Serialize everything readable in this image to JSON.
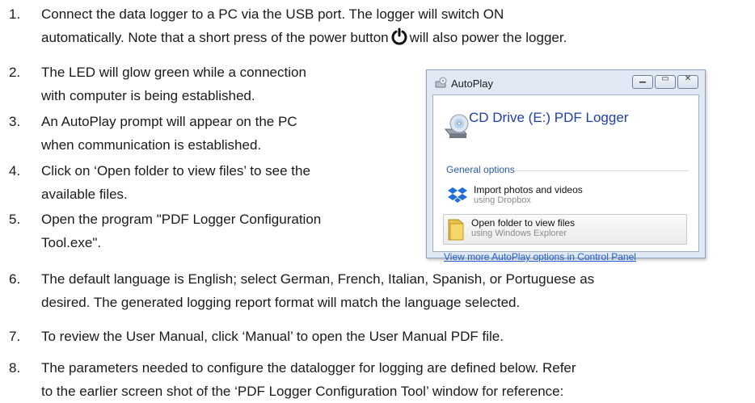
{
  "steps": [
    {
      "num": "1.",
      "lines": [
        "Connect the data logger to a PC via the USB port. The logger will switch ON",
        "automatically. Note that a short press of the power button",
        "will also power the logger."
      ]
    },
    {
      "num": "2.",
      "lines": [
        "The LED will glow green while a connection",
        "with computer is being established."
      ]
    },
    {
      "num": "3.",
      "lines": [
        "An AutoPlay prompt will appear on the PC",
        "when communication is established."
      ]
    },
    {
      "num": "4.",
      "lines": [
        "Click on ‘Open folder to view files’ to see the",
        "available files."
      ]
    },
    {
      "num": "5.",
      "lines": [
        "Open the program \"PDF Logger Configuration",
        "Tool.exe\"."
      ]
    },
    {
      "num": "6.",
      "lines": [
        "The default language is English; select German, French, Italian, Spanish, or Portuguese as",
        "desired. The generated logging report format will match the language selected."
      ]
    },
    {
      "num": "7.",
      "lines": [
        "To review the User Manual, click ‘Manual’ to open the User Manual PDF file."
      ]
    },
    {
      "num": "8.",
      "lines": [
        "The parameters needed to configure the datalogger for logging are defined below. Refer",
        "to the earlier screen shot of the ‘PDF Logger Configuration Tool’ window for reference:"
      ]
    }
  ],
  "icons": {
    "power": "power-icon"
  },
  "dialog": {
    "title": "AutoPlay",
    "drive_name": "CD Drive (E:) PDF Logger",
    "section_label": "General options",
    "option1": {
      "title": "Import photos and videos",
      "sub": "using Dropbox"
    },
    "option2": {
      "title": "Open folder to view files",
      "sub": "using Windows Explorer"
    },
    "more_link": "View more AutoPlay options in Control Panel"
  }
}
